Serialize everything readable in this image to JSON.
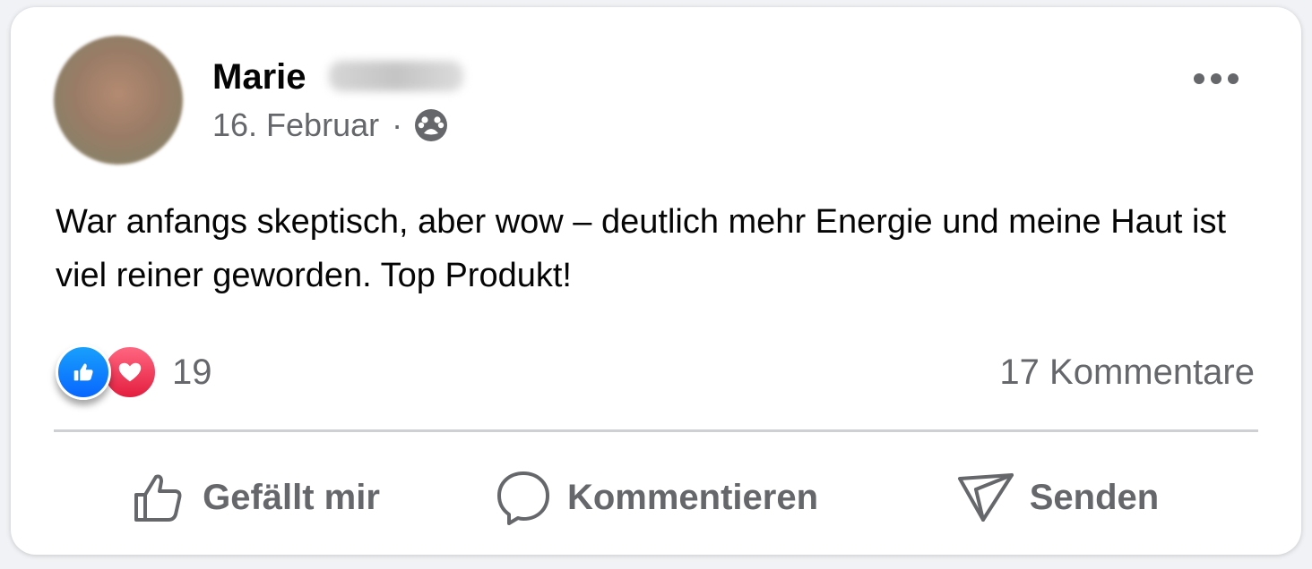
{
  "post": {
    "author": {
      "first_name": "Marie",
      "surname_blurred": true
    },
    "date": "16. Februar",
    "separator": "·",
    "audience_icon": "friends-audience-icon",
    "text": "War anfangs skeptisch, aber wow – deutlich mehr Energie und meine Haut ist viel reiner geworden. Top Produkt!",
    "more_icon": "more-options-icon"
  },
  "reactions": {
    "types": [
      "like",
      "love"
    ],
    "count": "19"
  },
  "comments": {
    "count_label": "17 Kommentare"
  },
  "actions": {
    "like_label": "Gefällt mir",
    "comment_label": "Kommentieren",
    "share_label": "Senden"
  },
  "colors": {
    "like_blue": "#0866ff",
    "love_red": "#e41e3f",
    "secondary_text": "#65676b",
    "primary_text": "#050505"
  }
}
